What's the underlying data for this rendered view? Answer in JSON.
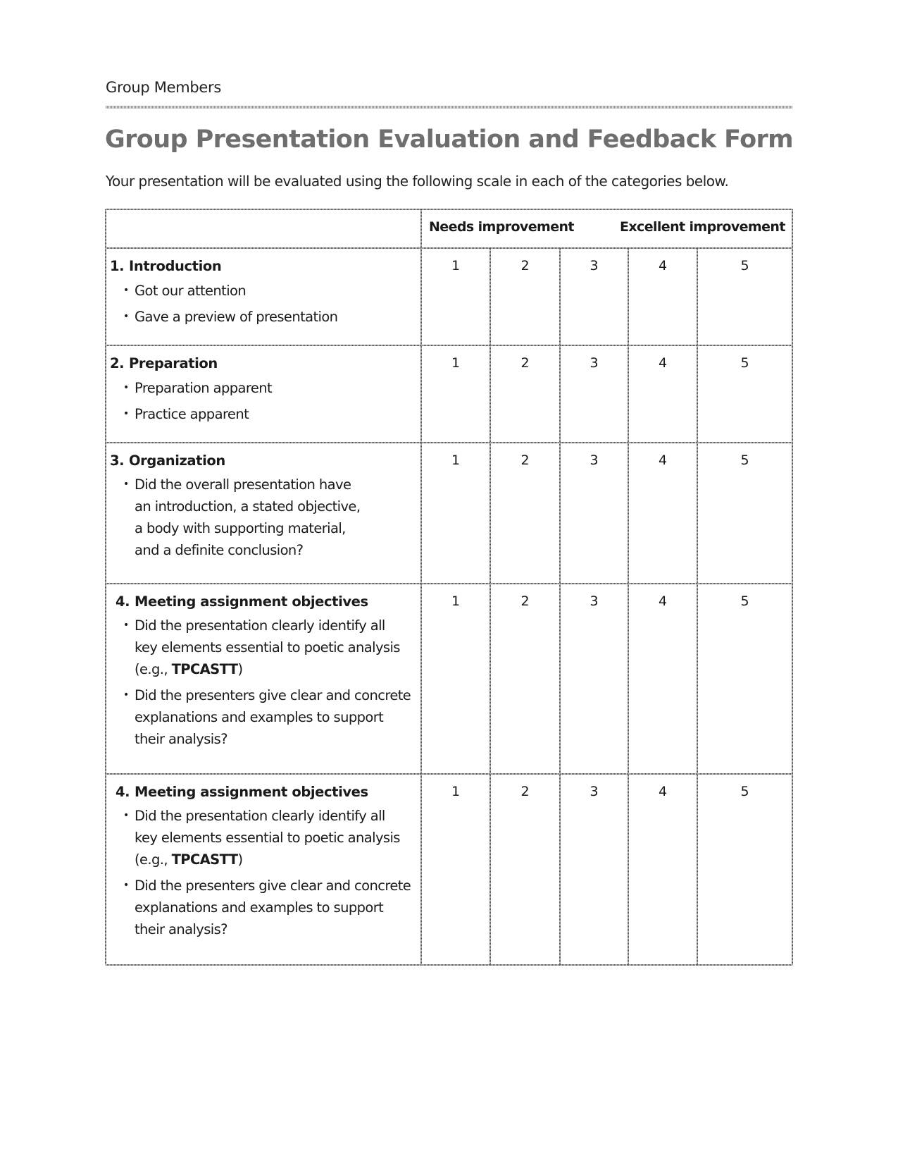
{
  "header": {
    "group_members_label": "Group Members",
    "title": "Group Presentation Evaluation and Feedback Form",
    "subtitle": "Your presentation will be evaluated using the following scale in each of the categories below."
  },
  "table": {
    "scale_low_label": "Needs improvement",
    "scale_high_label": "Excellent improvement",
    "scale": [
      "1",
      "2",
      "3",
      "4",
      "5"
    ],
    "rows": [
      {
        "number": "1.",
        "title": "Introduction",
        "bullets": [
          {
            "lines": [
              "Got our attention"
            ]
          },
          {
            "lines": [
              "Gave a preview of presentation"
            ]
          }
        ]
      },
      {
        "number": "2.",
        "title": "Preparation",
        "bullets": [
          {
            "lines": [
              "Preparation apparent"
            ]
          },
          {
            "lines": [
              "Practice apparent"
            ]
          }
        ]
      },
      {
        "number": "3.",
        "title": "Organization",
        "bullets": [
          {
            "lines": [
              "Did the overall presentation have",
              "an introduction, a stated objective,",
              "a body with supporting material,",
              "and a definite conclusion?"
            ]
          }
        ]
      },
      {
        "number": "4.",
        "title": "Meeting assignment objectives",
        "bullets": [
          {
            "lines": [
              "Did the presentation clearly identify all",
              "key elements essential to poetic analysis",
              "(e.g., TPCASTT)"
            ]
          },
          {
            "lines": [
              "Did the presenters give clear and concrete",
              "explanations and examples to support",
              "their analysis?"
            ]
          }
        ]
      },
      {
        "number": "4.",
        "title": "Meeting assignment objectives",
        "bullets": [
          {
            "lines": [
              "Did the presentation clearly identify all",
              "key elements essential to poetic analysis",
              "(e.g., TPCASTT)"
            ]
          },
          {
            "lines": [
              "Did the presenters give clear and concrete",
              "explanations and examples to support",
              "their analysis?"
            ]
          }
        ]
      }
    ]
  }
}
